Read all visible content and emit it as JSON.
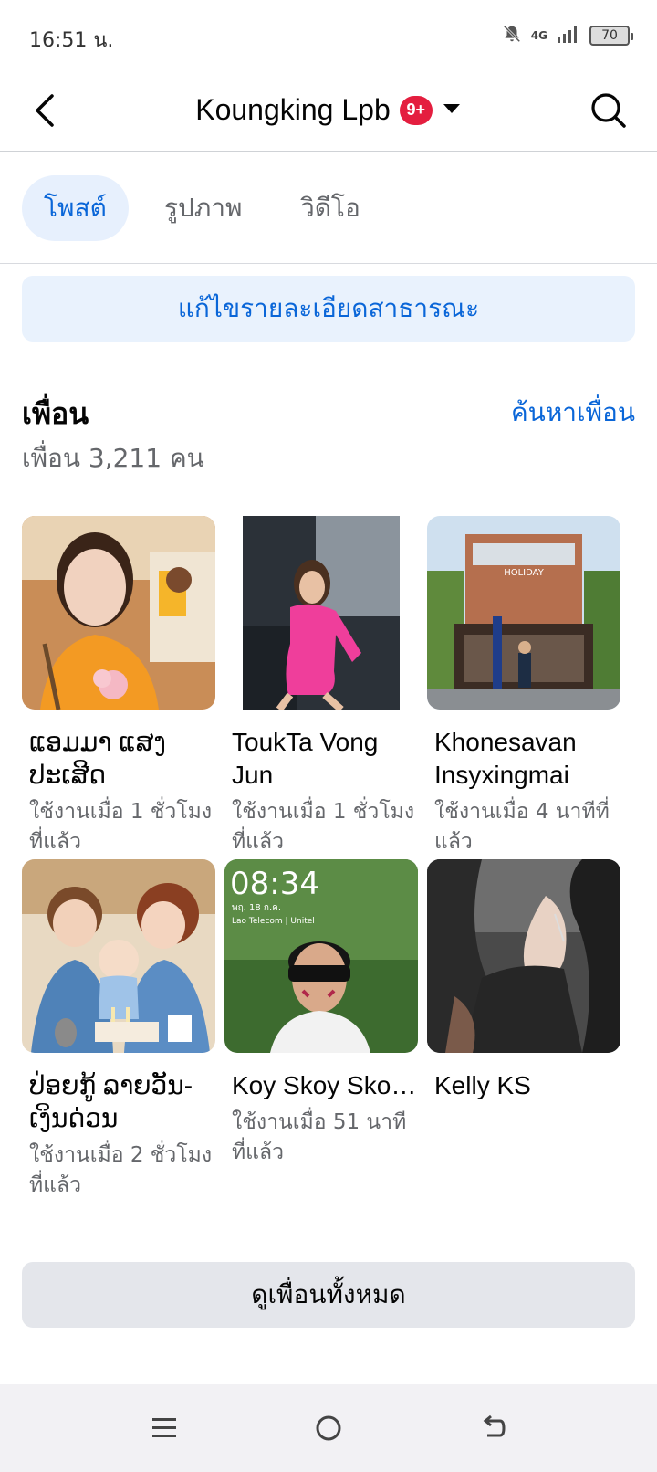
{
  "status_bar": {
    "time": "16:51 น.",
    "network": "4G",
    "battery": "70"
  },
  "header": {
    "title": "Koungking Lpb",
    "badge": "9+"
  },
  "tabs": [
    {
      "label": "โพสต์",
      "active": true
    },
    {
      "label": "รูปภาพ",
      "active": false
    },
    {
      "label": "วิดีโอ",
      "active": false
    }
  ],
  "edit_public_details_label": "แก้ไขรายละเอียดสาธารณะ",
  "friends": {
    "heading": "เพื่อน",
    "find_friends_label": "ค้นหาเพื่อน",
    "count_text": "เพื่อน 3,211 คน",
    "items": [
      {
        "name": "ແອມມາ ແສງ ປະເສີດ",
        "active": "ใช้งานเมื่อ 1 ชั่วโมงที่แล้ว"
      },
      {
        "name": "ToukTa Vong Jun",
        "active": "ใช้งานเมื่อ 1 ชั่วโมงที่แล้ว"
      },
      {
        "name": "Khonesavan Insyxingmai",
        "active": "ใช้งานเมื่อ 4 นาทีที่แล้ว"
      },
      {
        "name": "ປ່ອຍກູ້ ລາຍວັນ-ເງິນດ່ວນ",
        "active": "ใช้งานเมื่อ 2 ชั่วโมงที่แล้ว"
      },
      {
        "name": "Koy Skoy Skoy Sitthiduanglu...",
        "active": "ใช้งานเมื่อ 51 นาทีที่แล้ว",
        "photo_text": {
          "clock": "08:34",
          "date": "พฤ. 18 ก.ค.",
          "carrier": "Lao Telecom | Unitel"
        }
      },
      {
        "name": "Kelly KS",
        "active": ""
      }
    ],
    "see_all_label": "ดูเพื่อนทั้งหมด"
  },
  "photo_caption_holiday": "HOLIDAY",
  "colors": {
    "accent": "#0a66d8",
    "badge": "#e41e3f"
  }
}
